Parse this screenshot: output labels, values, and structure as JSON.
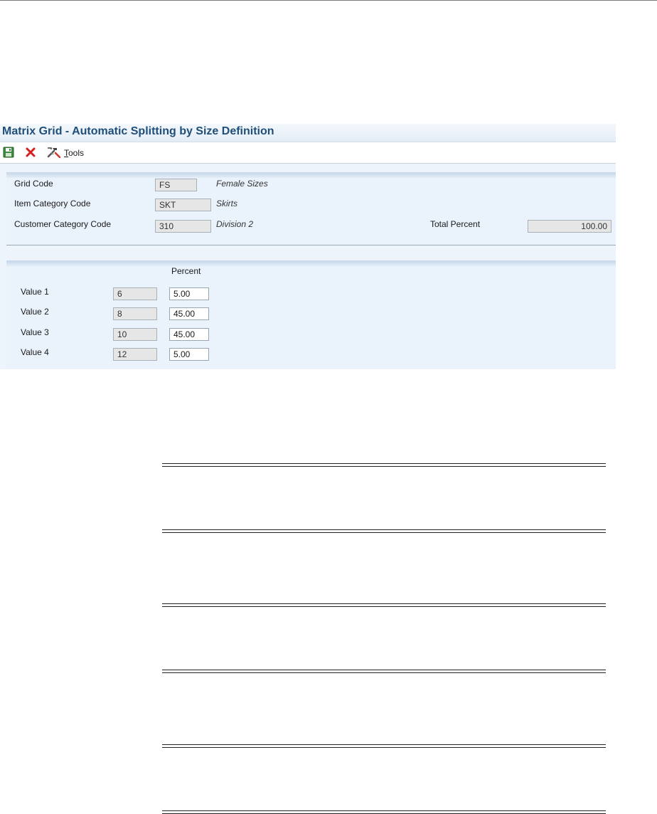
{
  "window": {
    "title": "Matrix Grid - Automatic Splitting by Size Definition"
  },
  "toolbar": {
    "save_icon": "save-icon",
    "cancel_icon": "close-icon",
    "tools_icon": "tools-icon",
    "tools_label_mnemonic": "T",
    "tools_label_rest": "ools"
  },
  "header": {
    "grid_code_label": "Grid Code",
    "grid_code_value": "FS",
    "grid_code_desc": "Female Sizes",
    "item_category_label": "Item Category Code",
    "item_category_value": "SKT",
    "item_category_desc": "Skirts",
    "customer_category_label": "Customer Category Code",
    "customer_category_value": "310",
    "customer_category_desc": "Division 2",
    "total_percent_label": "Total Percent",
    "total_percent_value": "100.00"
  },
  "values": {
    "percent_header": "Percent",
    "rows": [
      {
        "label": "Value 1",
        "size": "6",
        "percent": "5.00"
      },
      {
        "label": "Value 2",
        "size": "8",
        "percent": "45.00"
      },
      {
        "label": "Value 3",
        "size": "10",
        "percent": "45.00"
      },
      {
        "label": "Value 4",
        "size": "12",
        "percent": "5.00"
      }
    ]
  },
  "colors": {
    "title": "#1f4e79",
    "panel_background": "#eaf2fb",
    "cancel_red": "#d42020"
  }
}
